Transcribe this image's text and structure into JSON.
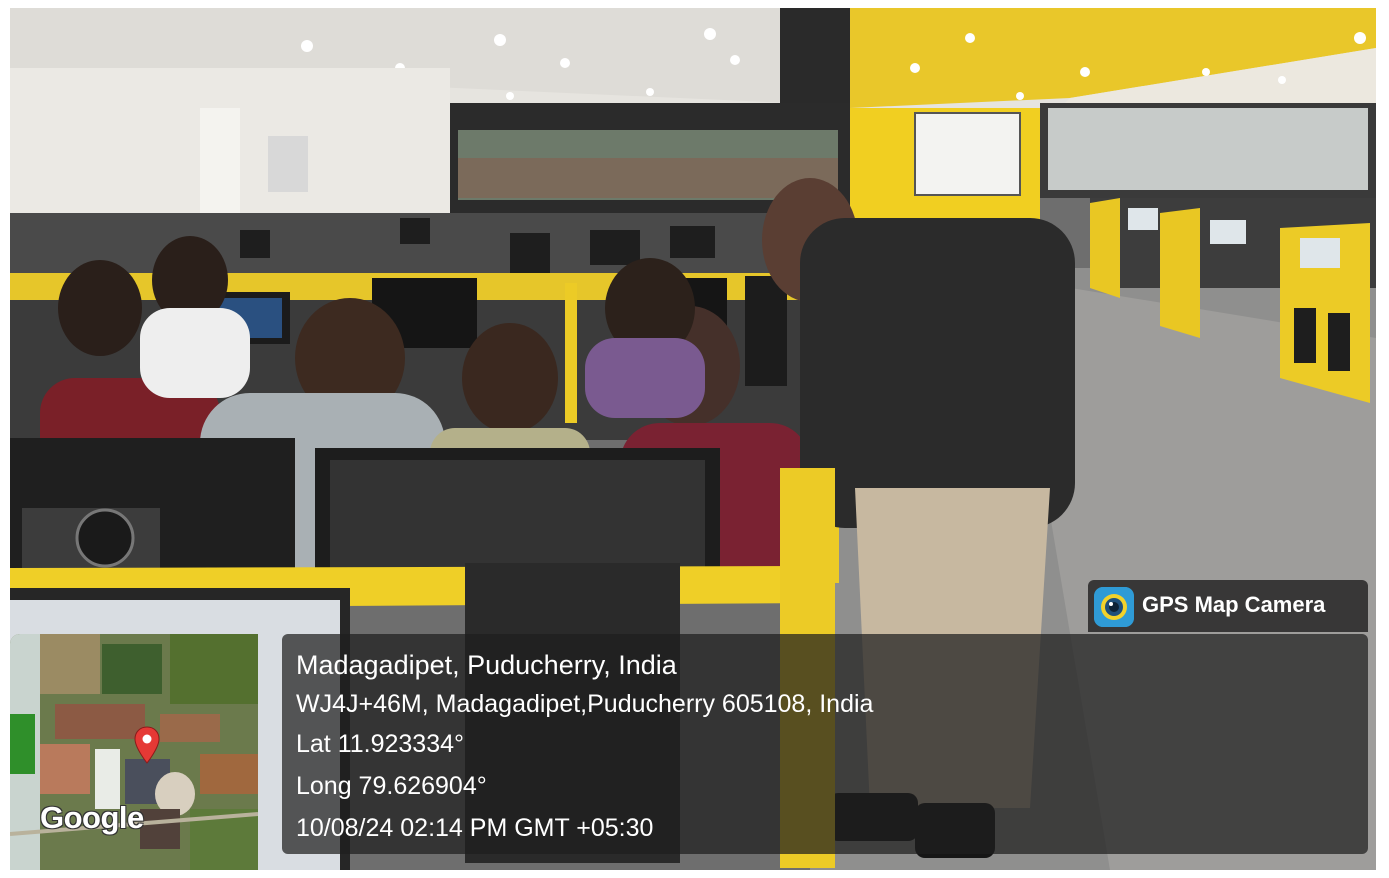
{
  "overlay": {
    "brand": "GPS Map Camera",
    "location_title": "Madagadipet, Puducherry, India",
    "address": "WJ4J+46M, Madagadipet,Puducherry 605108, India",
    "latitude": "Lat 11.923334°",
    "longitude": "Long 79.626904°",
    "timestamp": "10/08/24 02:14 PM GMT +05:30",
    "map_logo": "Google"
  },
  "icons": {
    "brand_icon": "camera-lens-icon",
    "map_pin": "map-pin-icon"
  },
  "colors": {
    "accent_yellow": "#f2d22b",
    "panel_bg": "#1e1e1e",
    "pin_red": "#e53935",
    "brand_icon_bg": "#2f9bd6"
  }
}
